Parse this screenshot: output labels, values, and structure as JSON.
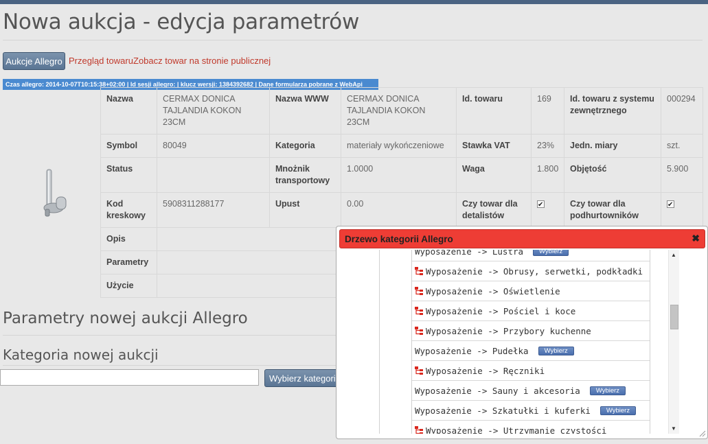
{
  "page": {
    "title": "Nowa aukcja - edycja parametrów"
  },
  "toolbar": {
    "auctions_button": "Aukcje Allegro",
    "links": [
      "Przegląd towaru",
      "Zobacz towar na stronie publicznej"
    ]
  },
  "info_bar": "Czas allegro: 2014-10-07T10:15:38+02:00 | Id sesji allegro: | klucz wersji: 1384392682 | Dane formularza pobrane z WebApi",
  "product": {
    "image_icon": "faucet-holder-icon",
    "rows": [
      [
        {
          "label": "Nazwa",
          "value": "CERMAX DONICA TAJLANDIA KOKON 23CM"
        },
        {
          "label": "Nazwa WWW",
          "value": "CERMAX DONICA TAJLANDIA KOKON 23CM"
        },
        {
          "label": "Id. towaru",
          "value": "169"
        },
        {
          "label": "Id. towaru z systemu zewnętrznego",
          "value": "000294"
        }
      ],
      [
        {
          "label": "Symbol",
          "value": "80049"
        },
        {
          "label": "Kategoria",
          "value": "materiały wykończeniowe"
        },
        {
          "label": "Stawka VAT",
          "value": "23%"
        },
        {
          "label": "Jedn. miary",
          "value": "szt."
        }
      ],
      [
        {
          "label": "Status",
          "value": ""
        },
        {
          "label": "Mnożnik transportowy",
          "value": "1.0000"
        },
        {
          "label": "Waga",
          "value": "1.800"
        },
        {
          "label": "Objętość",
          "value": "5.900"
        }
      ],
      [
        {
          "label": "Kod kreskowy",
          "value": "5908311288177"
        },
        {
          "label": "Upust",
          "value": "0.00"
        },
        {
          "label": "Czy towar dla detalistów",
          "checked": true
        },
        {
          "label": "Czy towar dla podhurtowników",
          "checked": true
        }
      ]
    ],
    "extra_rows": [
      "Opis",
      "Parametry",
      "Użycie"
    ]
  },
  "sections": {
    "params_title": "Parametry nowej aukcji Allegro",
    "category_title": "Kategoria nowej aukcji",
    "category_input_value": "",
    "choose_category_button": "Wybierz kategorię"
  },
  "dialog": {
    "title": "Drzewo kategorii Allegro",
    "close_glyph": "✖",
    "pick_label": "Wybierz",
    "items": [
      {
        "text": "Wyposażenie -> Lustra",
        "has_children": false,
        "pickable": true
      },
      {
        "text": "Wyposażenie -> Obrusy, serwetki, podkładki",
        "has_children": true,
        "pickable": false
      },
      {
        "text": "Wyposażenie -> Oświetlenie",
        "has_children": true,
        "pickable": false
      },
      {
        "text": "Wyposażenie -> Pościel i koce",
        "has_children": true,
        "pickable": false
      },
      {
        "text": "Wyposażenie -> Przybory kuchenne",
        "has_children": true,
        "pickable": false
      },
      {
        "text": "Wyposażenie -> Pudełka",
        "has_children": false,
        "pickable": true
      },
      {
        "text": "Wyposażenie -> Ręczniki",
        "has_children": true,
        "pickable": false
      },
      {
        "text": "Wyposażenie -> Sauny i akcesoria",
        "has_children": false,
        "pickable": true
      },
      {
        "text": "Wyposażenie -> Szkatułki i kuferki",
        "has_children": false,
        "pickable": true
      },
      {
        "text": "Wyposażenie -> Utrzymanie czystości",
        "has_children": true,
        "pickable": false
      }
    ]
  },
  "colors": {
    "topbar": "#4a6382",
    "button": "#5a7594",
    "link": "#c0392b",
    "info_bar": "#4a8ad0",
    "dialog_header": "#ee3d35",
    "pick_button": "#4a6fae",
    "tree_icon": "#d9261c"
  }
}
